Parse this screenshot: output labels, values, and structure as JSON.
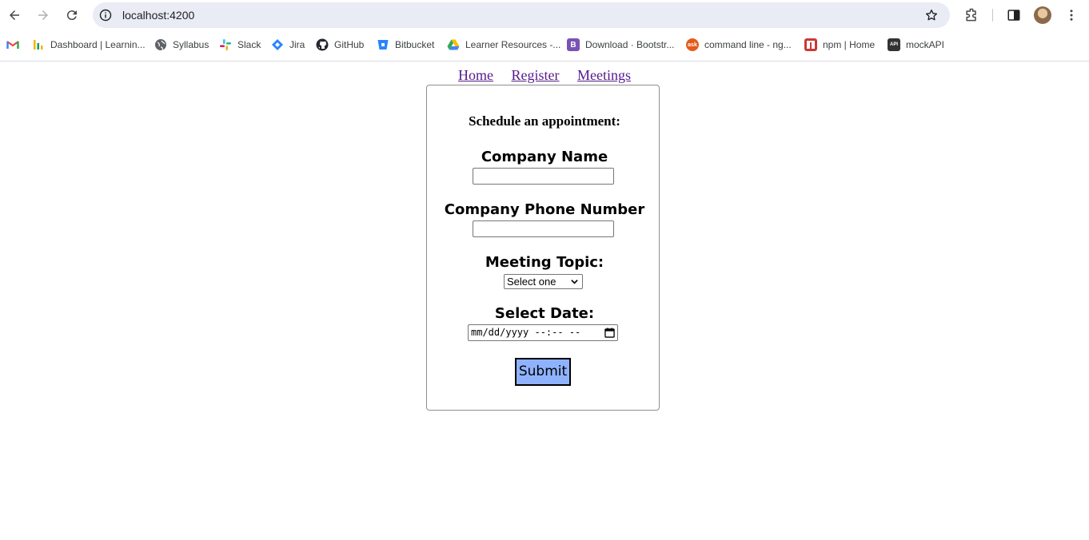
{
  "browser": {
    "url": "localhost:4200",
    "bookmarks": [
      {
        "label": "",
        "icon": "gmail-icon",
        "color": "#ea4335"
      },
      {
        "label": "Dashboard | Learnin...",
        "icon": "dashboard-icon",
        "color": "#f4b400"
      },
      {
        "label": "Syllabus",
        "icon": "globe-icon",
        "color": "#5f6368"
      },
      {
        "label": "Slack",
        "icon": "slack-icon",
        "color": "#e01e5a"
      },
      {
        "label": "Jira",
        "icon": "jira-icon",
        "color": "#2684ff"
      },
      {
        "label": "GitHub",
        "icon": "github-icon",
        "color": "#24292f"
      },
      {
        "label": "Bitbucket",
        "icon": "bitbucket-icon",
        "color": "#2684ff"
      },
      {
        "label": "Learner Resources -...",
        "icon": "google-drive-icon",
        "color": "#34a853"
      },
      {
        "label": "Download · Bootstr...",
        "icon": "bootstrap-icon",
        "color": "#7952b3"
      },
      {
        "label": "command line - ng...",
        "icon": "ask-icon",
        "color": "#e35b1b"
      },
      {
        "label": "npm | Home",
        "icon": "npm-icon",
        "color": "#cb3837"
      },
      {
        "label": "mockAPI",
        "icon": "mockapi-icon",
        "color": "#333333"
      }
    ]
  },
  "nav": {
    "home": "Home",
    "register": "Register",
    "meetings": "Meetings"
  },
  "form": {
    "title": "Schedule an appointment:",
    "company_name_label": "Company Name",
    "company_name_value": "",
    "company_phone_label": "Company Phone Number",
    "company_phone_value": "",
    "meeting_topic_label": "Meeting Topic:",
    "meeting_topic_selected": "Select one",
    "date_label": "Select Date:",
    "date_placeholder": "mm/dd/yyyy --:-- --",
    "submit_label": "Submit"
  },
  "colors": {
    "link": "#551a8b",
    "submit_bg": "#8fb2ff",
    "omnibox_bg": "#e9ecf5"
  }
}
